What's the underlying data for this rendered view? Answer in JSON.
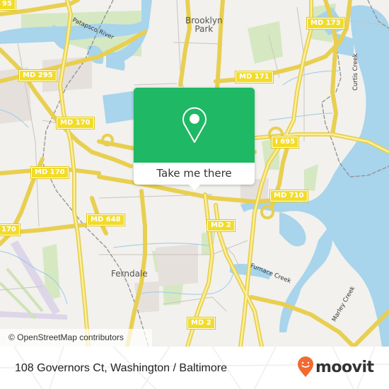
{
  "map": {
    "place_labels": {
      "brooklyn_park": "Brooklyn\nPark",
      "ferndale": "Ferndale"
    },
    "water_labels": {
      "patapsco": "Patapsco River",
      "curtis": "Curtis Creek",
      "furnace": "Furnace Creek",
      "marley": "Marley Creek"
    },
    "shields": {
      "md295": "MD 295",
      "md173": "MD 173",
      "md171": "MD 171",
      "md170a": "MD 170",
      "md170b": "MD 170",
      "md170c": "170",
      "i695": "I 695",
      "md710": "MD 710",
      "md648": "MD 648",
      "md2a": "MD 2",
      "md2b": "MD 2",
      "top_left": "95"
    },
    "attribution": "© OpenStreetMap contributors"
  },
  "popup": {
    "icon": "location-pin-icon",
    "button_label": "Take me there",
    "color": "#1fb864"
  },
  "footer": {
    "address": "108 Governors Ct, Washington / Baltimore",
    "logo_text": "moovit",
    "logo_color": "#f26a30"
  }
}
